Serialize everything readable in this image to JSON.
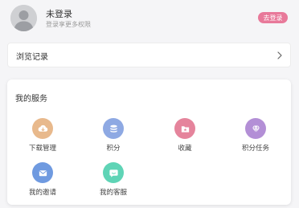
{
  "profile": {
    "name": "未登录",
    "subtitle": "登录享更多权限",
    "login_button": "去登录",
    "avatar_icon": "default-user-avatar"
  },
  "history": {
    "label": "浏览记录",
    "chevron_icon": "chevron-right-icon"
  },
  "services": {
    "title": "我的服务",
    "items": [
      {
        "label": "下载管理",
        "icon": "download-icon",
        "color": "#e8b98c"
      },
      {
        "label": "积分",
        "icon": "coins-icon",
        "color": "#8ea9e3"
      },
      {
        "label": "收藏",
        "icon": "folder-star-icon",
        "color": "#e5849c"
      },
      {
        "label": "积分任务",
        "icon": "diamond-icon",
        "color": "#b38fd6"
      },
      {
        "label": "我的邀请",
        "icon": "envelope-icon",
        "color": "#6f9ae0"
      },
      {
        "label": "我的客服",
        "icon": "chat-bubble-icon",
        "color": "#5fd4b6"
      }
    ]
  },
  "colors": {
    "accent_pink": "#e8799a",
    "background": "#f5f5f7"
  }
}
